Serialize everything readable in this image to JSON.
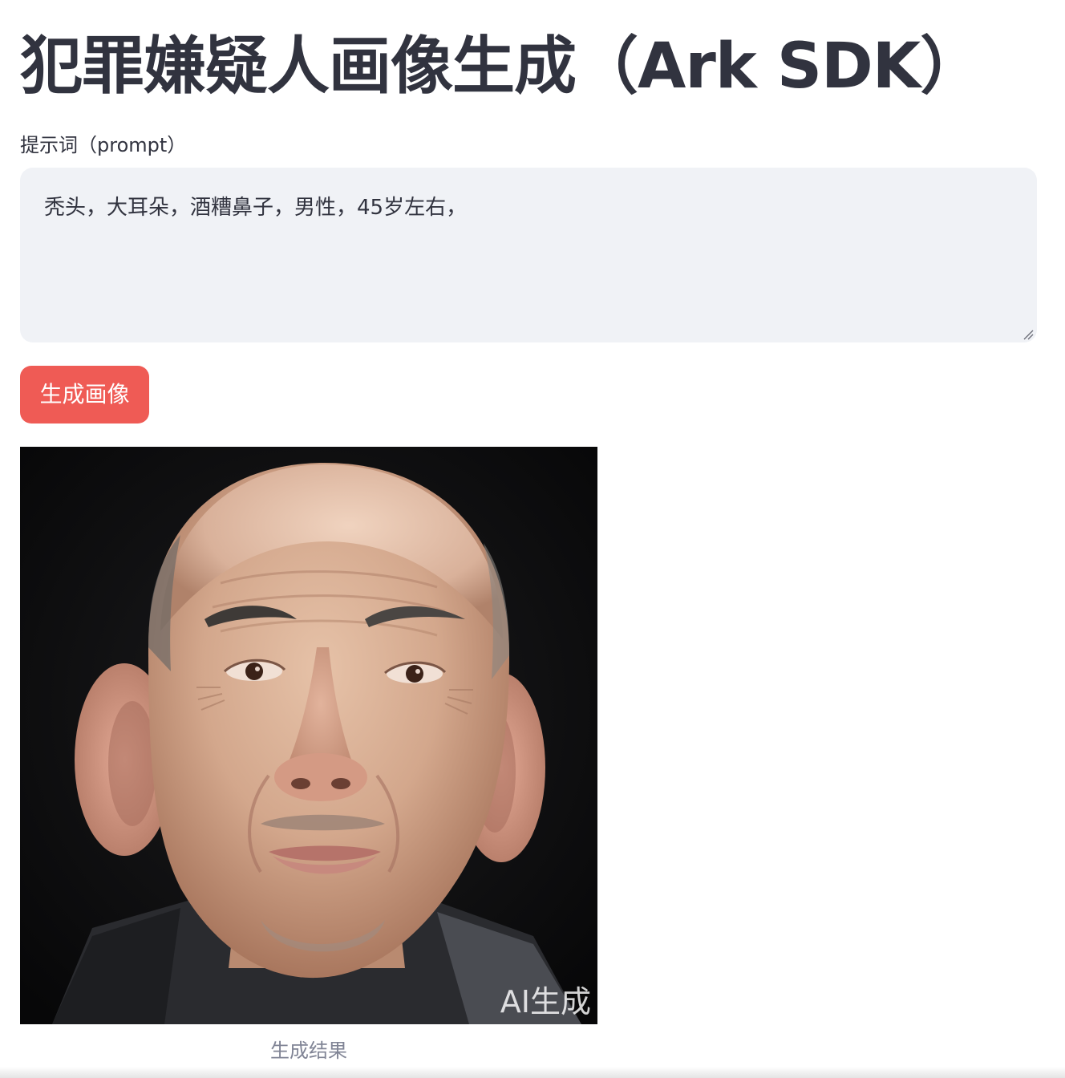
{
  "page": {
    "title": "犯罪嫌疑人画像生成（Ark SDK）"
  },
  "prompt_field": {
    "label": "提示词（prompt）",
    "value": "秃头，大耳朵，酒糟鼻子，男性，45岁左右，"
  },
  "generate_button": {
    "label": "生成画像"
  },
  "result_image": {
    "watermark": "AI生成",
    "caption": "生成结果"
  },
  "colors": {
    "accent_button": "#ef5b55",
    "textarea_bg": "#f0f2f6",
    "text": "#31333f",
    "caption_text": "#808495"
  }
}
